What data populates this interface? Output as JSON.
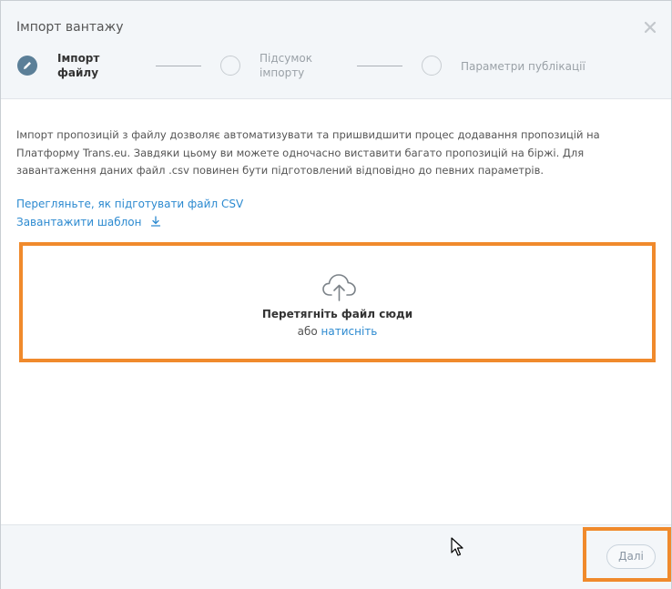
{
  "dialog": {
    "title": "Імпорт вантажу",
    "close_icon": "close-icon"
  },
  "steps": [
    {
      "label_line1": "Імпорт",
      "label_line2": "файлу",
      "state": "active",
      "icon": "pencil-icon"
    },
    {
      "label_line1": "Підсумок",
      "label_line2": "імпорту",
      "state": "inactive"
    },
    {
      "label_line1": "Параметри публікації",
      "label_line2": "",
      "state": "inactive"
    }
  ],
  "description": {
    "text": "Імпорт пропозицій з файлу дозволяє автоматизувати та пришвидшити процес додавання пропозицій на Платформу Trans.eu. Завдяки цьому ви можете одночасно виставити багато пропозицій на біржі. Для завантаження даних файл .csv повинен бути підготовлений відповідно до певних параметрів."
  },
  "links": {
    "how_to_prepare": "Перегляньте, як підготувати файл CSV",
    "download_template": "Завантажити шаблон",
    "download_icon": "download-icon"
  },
  "dropzone": {
    "icon": "cloud-upload-icon",
    "main_text": "Перетягніть файл сюди",
    "or_text": "або",
    "click_text": "натисніть"
  },
  "footer": {
    "next_label": "Далі"
  },
  "colors": {
    "accent_link": "#2c8ad0",
    "highlight": "#f08a2c",
    "active_step": "#5b7f98",
    "header_bg": "#f3f6f9"
  }
}
